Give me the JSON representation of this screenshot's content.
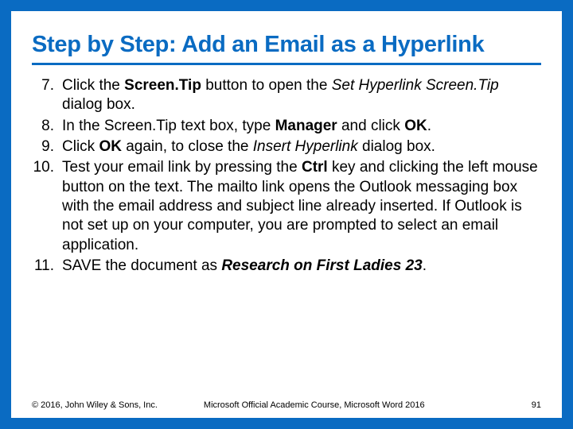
{
  "title": "Step by Step: Add an Email as a Hyperlink",
  "steps": [
    {
      "num": "7.",
      "parts": [
        {
          "t": "Click the ",
          "c": ""
        },
        {
          "t": "Screen.Tip",
          "c": "b"
        },
        {
          "t": " button to open the ",
          "c": ""
        },
        {
          "t": "Set Hyperlink Screen.Tip",
          "c": "i"
        },
        {
          "t": " dialog box.",
          "c": ""
        }
      ]
    },
    {
      "num": "8.",
      "parts": [
        {
          "t": "In the Screen.Tip text box, type ",
          "c": ""
        },
        {
          "t": "Manager",
          "c": "b"
        },
        {
          "t": " and click ",
          "c": ""
        },
        {
          "t": "OK",
          "c": "b"
        },
        {
          "t": ".",
          "c": ""
        }
      ]
    },
    {
      "num": "9.",
      "parts": [
        {
          "t": "Click ",
          "c": ""
        },
        {
          "t": "OK",
          "c": "b"
        },
        {
          "t": " again, to close the ",
          "c": ""
        },
        {
          "t": "Insert Hyperlink",
          "c": "i"
        },
        {
          "t": " dialog box.",
          "c": ""
        }
      ]
    },
    {
      "num": "10.",
      "parts": [
        {
          "t": "Test your email link by pressing the ",
          "c": ""
        },
        {
          "t": "Ctrl",
          "c": "b"
        },
        {
          "t": " key and clicking the left mouse button on the text. The mailto link opens the Outlook messaging box with the email address and subject line already inserted. If Outlook is not set up on your computer, you are prompted to select an email application.",
          "c": ""
        }
      ]
    },
    {
      "num": "11.",
      "parts": [
        {
          "t": "SAVE the document as ",
          "c": ""
        },
        {
          "t": "Research on First Ladies 23",
          "c": "bi"
        },
        {
          "t": ".",
          "c": ""
        }
      ]
    }
  ],
  "footer": {
    "copyright": "© 2016, John Wiley & Sons, Inc.",
    "course": "Microsoft Official Academic Course, Microsoft Word 2016",
    "pagenum": "91"
  }
}
